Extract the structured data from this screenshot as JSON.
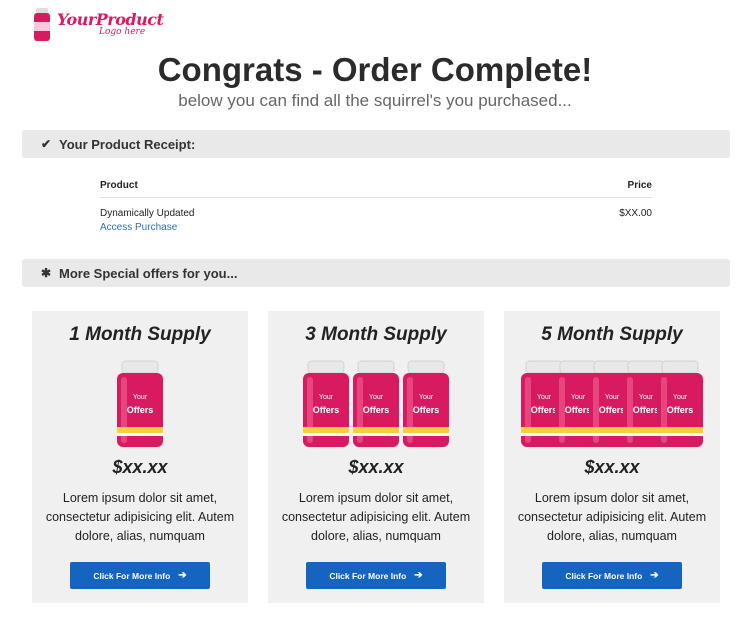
{
  "logo": {
    "text": "YourProduct",
    "sub": "Logo here"
  },
  "header": {
    "title": "Congrats - Order Complete!",
    "subtitle": "below you can find all the squirrel's you purchased..."
  },
  "receipt_section": {
    "icon": "check-icon",
    "label": "Your Product Receipt:"
  },
  "receipt": {
    "col_product": "Product",
    "col_price": "Price",
    "item_name": "Dynamically Updated",
    "item_link": "Access Purchase",
    "item_price": "$XX.00"
  },
  "offers_section": {
    "icon": "asterisk-icon",
    "label": "More Special offers for you..."
  },
  "offers": [
    {
      "title": "1 Month Supply",
      "bottle_count": 1,
      "price": "$xx.xx",
      "desc": "Lorem ipsum dolor sit amet, consectetur adipisicing elit. Autem dolore, alias, numquam",
      "button": "Click For More Info"
    },
    {
      "title": "3 Month Supply",
      "bottle_count": 3,
      "price": "$xx.xx",
      "desc": "Lorem ipsum dolor sit amet, consectetur adipisicing elit. Autem dolore, alias, numquam",
      "button": "Click For More Info"
    },
    {
      "title": "5 Month Supply",
      "bottle_count": 5,
      "price": "$xx.xx",
      "desc": "Lorem ipsum dolor sit amet, consectetur adipisicing elit. Autem dolore, alias, numquam",
      "button": "Click For More Info"
    }
  ],
  "bottle_label": {
    "line1": "Your",
    "line2": "Offers"
  },
  "colors": {
    "brand": "#d81b60",
    "button": "#1565c0",
    "link": "#2f6fc1",
    "bar": "#e9e9e9"
  }
}
